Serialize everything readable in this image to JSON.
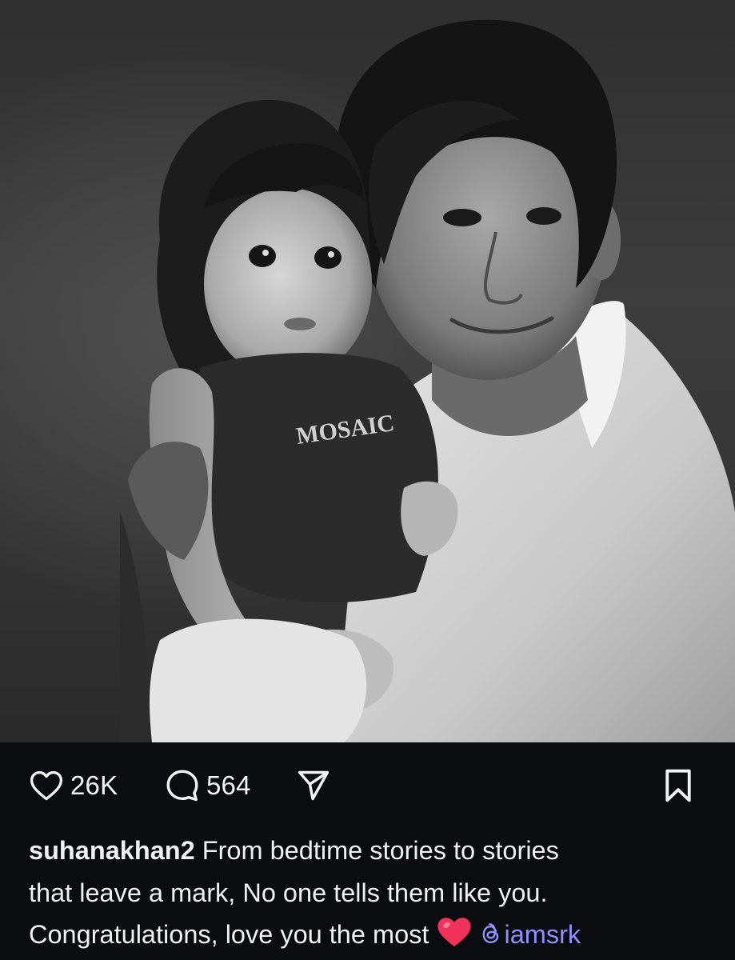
{
  "photo": {
    "alt_subject": "black-and-white-photo",
    "shirt_text": "MOSAIC"
  },
  "actions": {
    "like_count": "26K",
    "comment_count": "564",
    "like_icon": "heart-outline-icon",
    "comment_icon": "speech-bubble-icon",
    "share_icon": "paper-plane-icon",
    "save_icon": "bookmark-icon"
  },
  "caption": {
    "username": "suhanakhan2",
    "text_line_1": "From bedtime stories to stories",
    "text_line_2": "that leave a mark, No one tells them like you.",
    "text_line_3": "Congratulations, love you the most",
    "emoji": "red-heart-emoji",
    "mention": "iamsrk",
    "mention_icon": "threads-icon"
  },
  "colors": {
    "background": "#0b0c10",
    "text": "#f0f0f0",
    "mention": "#8f8fff",
    "heart_emoji": "#f0325a"
  }
}
